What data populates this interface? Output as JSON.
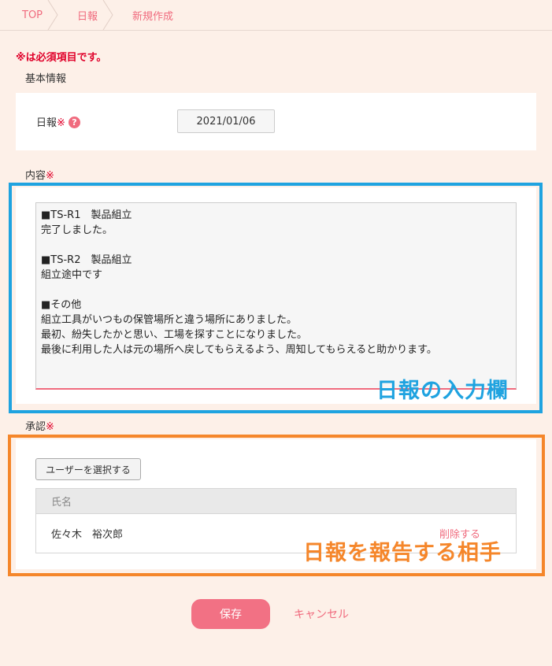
{
  "breadcrumb": {
    "items": [
      "TOP",
      "日報",
      "新規作成"
    ]
  },
  "required_note": "※は必須項目です。",
  "required_mark": "※",
  "basic_info": {
    "section_label": "基本情報",
    "date_label": "日報",
    "help_icon": "?",
    "date_value": "2021/01/06"
  },
  "content": {
    "section_label": "内容",
    "text": "■TS-R1　製品組立\n完了しました。\n\n■TS-R2　製品組立\n組立途中です\n\n■その他\n組立工具がいつもの保管場所と違う場所にありました。\n最初、紛失したかと思い、工場を探すことになりました。\n最後に利用した人は元の場所へ戻してもらえるよう、周知してもらえると助かります。"
  },
  "approval": {
    "section_label": "承認",
    "select_button": "ユーザーを選択する",
    "column_name": "氏名",
    "rows": [
      {
        "name": "佐々木　裕次郎",
        "action": "削除する"
      }
    ]
  },
  "annotations": {
    "input_area": "日報の入力欄",
    "report_target": "日報を報告する相手"
  },
  "actions": {
    "save": "保存",
    "cancel": "キャンセル"
  },
  "colors": {
    "accent": "#f06b7e",
    "required": "#e0002a",
    "highlight_blue": "#1fa3e0",
    "highlight_orange": "#f5862a",
    "background": "#fdf0e8"
  }
}
